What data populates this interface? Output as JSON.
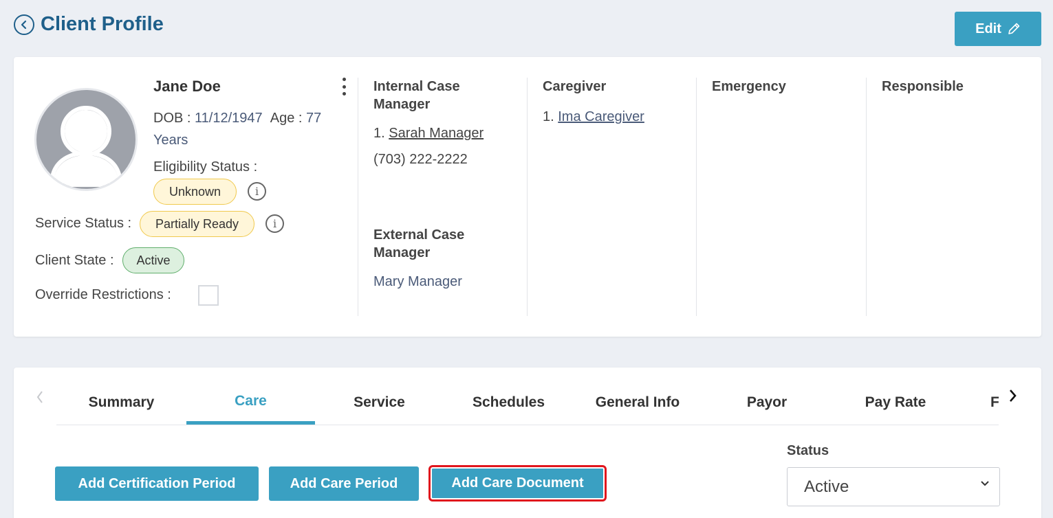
{
  "header": {
    "title": "Client Profile",
    "edit_label": "Edit"
  },
  "client": {
    "name": "Jane Doe",
    "dob_label": "DOB :",
    "dob": "11/12/1947",
    "age_label": "Age :",
    "age_value": "77",
    "age_unit": "Years",
    "eligibility_label": "Eligibility Status :",
    "eligibility_value": "Unknown",
    "service_status_label": "Service Status :",
    "service_status_value": "Partially Ready",
    "client_state_label": "Client State :",
    "client_state_value": "Active",
    "override_label": "Override Restrictions :",
    "override_checked": false
  },
  "internal_case_manager": {
    "heading_line1": "Internal Case",
    "heading_line2": "Manager",
    "item_index": "1.",
    "name": "Sarah Manager",
    "phone": "(703) 222-2222"
  },
  "external_case_manager": {
    "heading_line1": "External Case",
    "heading_line2": "Manager",
    "name": "Mary Manager"
  },
  "caregiver": {
    "heading": "Caregiver",
    "item_index": "1.",
    "name": "Ima Caregiver"
  },
  "emergency": {
    "heading": "Emergency"
  },
  "responsible": {
    "heading": "Responsible"
  },
  "tabs": [
    {
      "label": "Summary",
      "active": false
    },
    {
      "label": "Care",
      "active": true
    },
    {
      "label": "Service",
      "active": false
    },
    {
      "label": "Schedules",
      "active": false
    },
    {
      "label": "General Info",
      "active": false
    },
    {
      "label": "Payor",
      "active": false
    },
    {
      "label": "Pay Rate",
      "active": false
    },
    {
      "label": "F",
      "active": false
    }
  ],
  "actions": {
    "add_certification_period": "Add Certification Period",
    "add_care_period": "Add Care Period",
    "add_care_document": "Add Care Document"
  },
  "status_filter": {
    "label": "Status",
    "selected": "Active"
  },
  "colors": {
    "accent": "#3aa0c2",
    "title": "#1e5f8a",
    "highlight": "#e0161d"
  }
}
